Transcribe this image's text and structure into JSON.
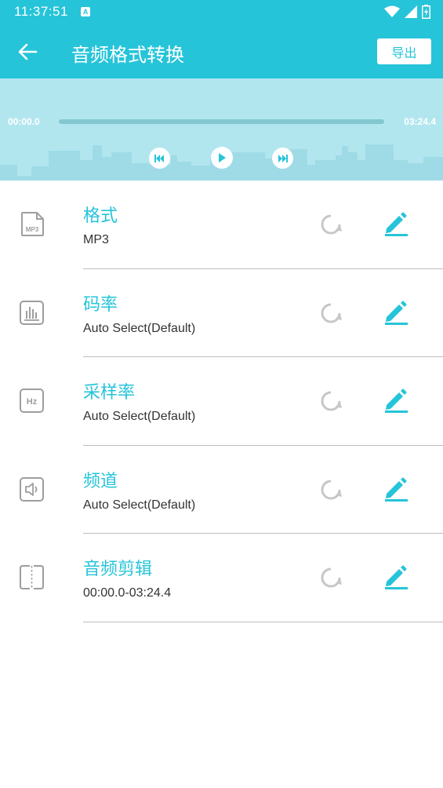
{
  "status_bar": {
    "time": "11:37:51",
    "notification_badge": "A",
    "icons": [
      "wifi-icon",
      "signal-icon",
      "battery-charging-icon"
    ]
  },
  "app_bar": {
    "back_icon": "arrow-left-icon",
    "title": "音频格式转换",
    "export_label": "导出"
  },
  "player": {
    "current_time": "00:00.0",
    "total_time": "03:24.4",
    "progress": 0.0,
    "controls": [
      "skip-previous-icon",
      "play-icon",
      "skip-next-icon"
    ]
  },
  "settings": [
    {
      "label": "格式",
      "value": "MP3",
      "icon": "mp3-file-icon"
    },
    {
      "label": "码率",
      "value": "Auto Select(Default)",
      "icon": "bar-chart-icon"
    },
    {
      "label": "采样率",
      "value": "Auto Select(Default)",
      "icon": "hz-icon"
    },
    {
      "label": "频道",
      "value": "Auto Select(Default)",
      "icon": "speaker-icon"
    },
    {
      "label": "音频剪辑",
      "value": "00:00.0-03:24.4",
      "icon": "split-icon"
    }
  ],
  "colors": {
    "primary": "#26c4d9",
    "player_bg": "#b2e6ef",
    "label_text": "#26c4d9",
    "value_text": "#333333",
    "icon_gray": "#9e9e9e",
    "divider": "#bdbdbd"
  }
}
